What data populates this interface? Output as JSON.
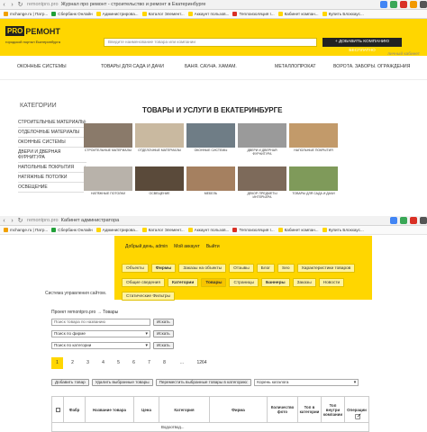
{
  "window1": {
    "url_domain": "remontpro.pro",
    "url_title": "Журнал про ремонт - строительство и ремонт в Екатеринбурге",
    "bookmarks": [
      "mchange.ru | Патр...",
      "Сбербанк Онлайн",
      "Администрирова...",
      "Каталог Элемент...",
      "Аккаунт пользов...",
      "Теплоизоляция I...",
      "Кабинет компан...",
      "Купить Блокхаус..."
    ],
    "logo_pro": "PRO",
    "logo_rem": "РЕМОНТ",
    "logo_sub": "городской портал Екатеринбурга",
    "search_placeholder": "Введите наименование товара или компании",
    "add_company": "+ ДОБАВИТЬ КОМПАНИЮ БЕСПЛАТНО",
    "login": "личный кабинет",
    "menu": [
      "ОКОННЫЕ СИСТЕМЫ",
      "ТОВАРЫ ДЛЯ САДА И ДАЧИ",
      "БАНЯ. САУНА. ХАМАМ.",
      "МЕТАЛЛОПРОКАТ",
      "ВОРОТА. ЗАБОРЫ. ОГРАЖДЕНИЯ"
    ],
    "categories_title": "КАТЕГОРИИ",
    "categories": [
      "СТРОИТЕЛЬНЫЕ МАТЕРИАЛЫ",
      "ОТДЕЛОЧНЫЕ МАТЕРИАЛЫ",
      "ОКОННЫЕ СИСТЕМЫ",
      "ДВЕРИ И ДВЕРНАЯ ФУРНИТУРА",
      "НАПОЛЬНЫЕ ПОКРЫТИЯ",
      "НАТЯЖНЫЕ ПОТОЛКИ",
      "ОСВЕЩЕНИЕ"
    ],
    "heading": "ТОВАРЫ И УСЛУГИ В ЕКАТЕРИНБУРГЕ",
    "tiles": [
      {
        "caption": "СТРОИТЕЛЬНЫЕ МАТЕРИАЛЫ",
        "color": "#8a7a6a"
      },
      {
        "caption": "ОТДЕЛОЧНЫЕ МАТЕРИАЛЫ",
        "color": "#c9b9a0"
      },
      {
        "caption": "ОКОННЫЕ СИСТЕМЫ",
        "color": "#6f7d86"
      },
      {
        "caption": "ДВЕРИ И ДВЕРНАЯ ФУРНИТУРА",
        "color": "#9a9a9a"
      },
      {
        "caption": "НАПОЛЬНЫЕ ПОКРЫТИЯ",
        "color": "#c29a6a"
      },
      {
        "caption": "НАТЯЖНЫЕ ПОТОЛКИ",
        "color": "#b8b2aa"
      },
      {
        "caption": "ОСВЕЩЕНИЕ",
        "color": "#5a4a3a"
      },
      {
        "caption": "МЕБЕЛЬ",
        "color": "#a58060"
      },
      {
        "caption": "ДЕКОР. ПРЕДМЕТЫ ИНТЕРЬЕРА",
        "color": "#7d6a5a"
      },
      {
        "caption": "ТОВАРЫ ДЛЯ САДА И ДАЧИ",
        "color": "#7f9a5a"
      }
    ]
  },
  "window2": {
    "url_domain": "remontpro.pro",
    "url_title": "Кабинет администратора",
    "greeting": "Добрый день, admin",
    "my_account": "Мой аккаунт",
    "logout": "Выйти",
    "tabs_row1": [
      {
        "label": "Объекты",
        "style": ""
      },
      {
        "label": "Фирмы",
        "style": "bold"
      },
      {
        "label": "Заказы на объекты",
        "style": ""
      },
      {
        "label": "Отзывы",
        "style": ""
      },
      {
        "label": "Блог",
        "style": ""
      },
      {
        "label": "Seo",
        "style": ""
      },
      {
        "label": "Характеристики товаров",
        "style": ""
      }
    ],
    "tabs_row2": [
      {
        "label": "Общие сведения",
        "style": ""
      },
      {
        "label": "Категории",
        "style": "bold"
      },
      {
        "label": "Товары",
        "style": "active"
      },
      {
        "label": "Страницы",
        "style": ""
      },
      {
        "label": "Баннеры",
        "style": "bold"
      },
      {
        "label": "Заказы",
        "style": ""
      },
      {
        "label": "Новости",
        "style": ""
      }
    ],
    "tabs_row3": [
      {
        "label": "Статические Фильтры",
        "style": ""
      }
    ],
    "cms_label": "Система управления сайтом.",
    "breadcrumbs": "Проект remontpro.pro → Товары",
    "search_placeholder": "Поиск товара по названию",
    "find_btn": "Искать",
    "firm_select": "Поиск по фирме",
    "category_select": "Поиск по категории",
    "pages": [
      "1",
      "2",
      "3",
      "4",
      "5",
      "6",
      "7",
      "8",
      "...",
      "1264"
    ],
    "current_page": "1",
    "add_product": "Добавить товар",
    "delete_selected": "Удалить выбранные товары",
    "move_selected": "Переместить выбранные товары в категорию:",
    "catalog_root": "Корень каталога",
    "columns": [
      "",
      "Фабр",
      "Название товара",
      "Цена",
      "Категория",
      "Фирма",
      "Количество фото",
      "Топ в категории",
      "Топ внутри компании",
      "Операции"
    ],
    "row1_category": "Водоотвод..."
  }
}
